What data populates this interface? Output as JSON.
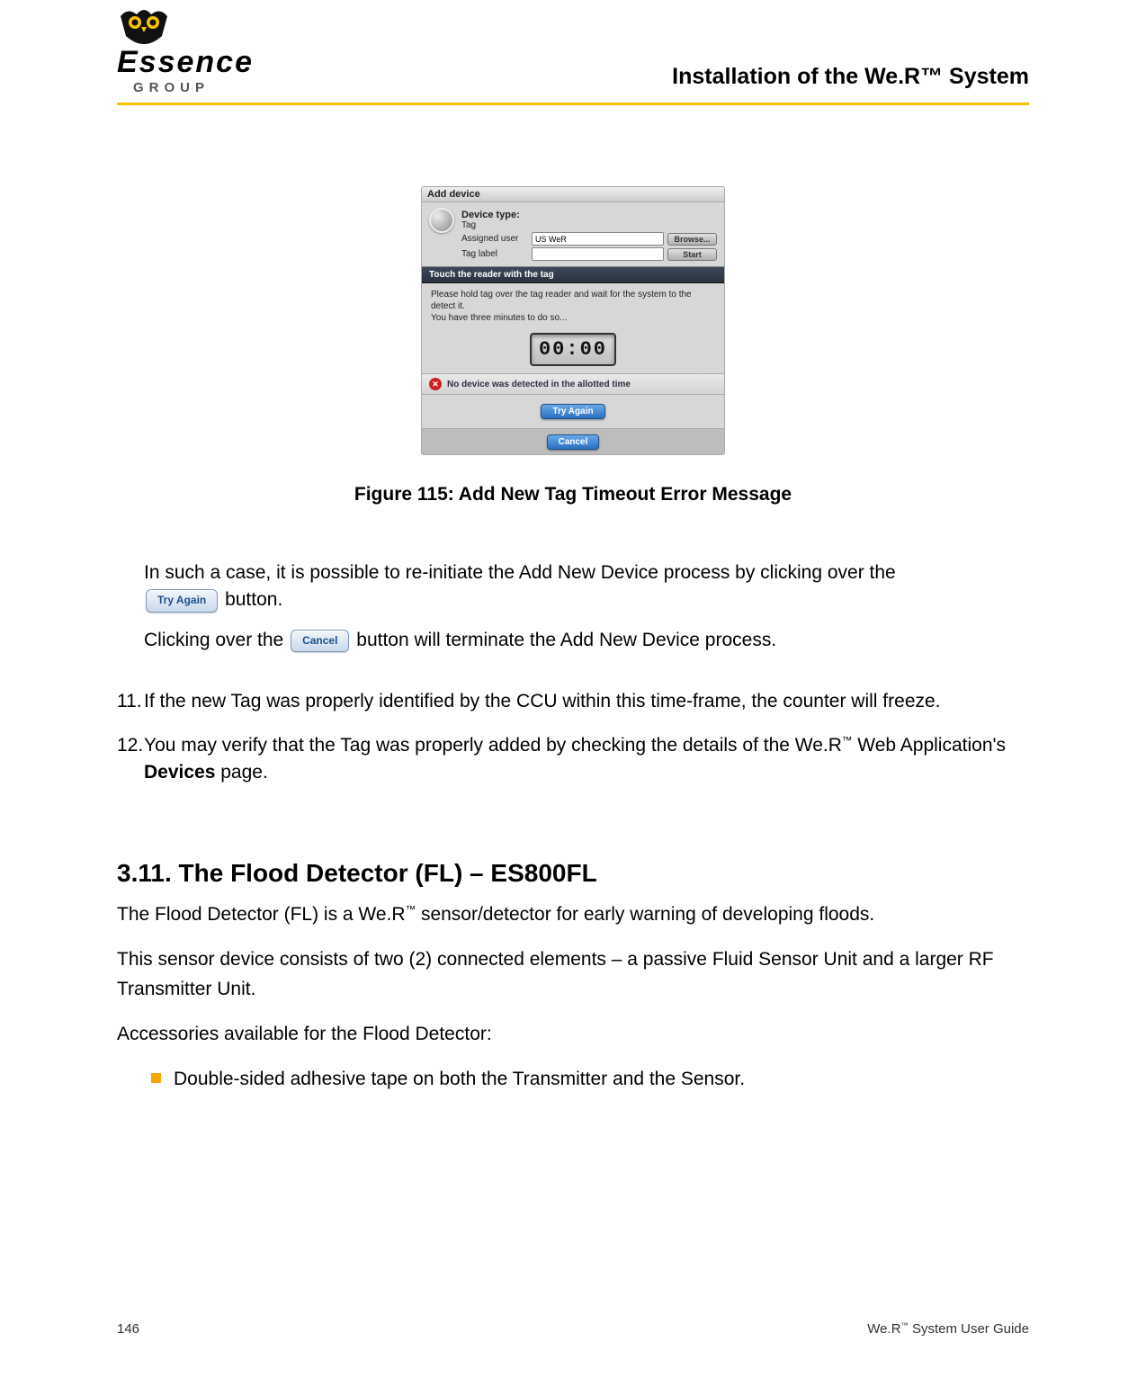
{
  "brand": {
    "name": "Essence",
    "sub": "GROUP"
  },
  "header_title": "Installation of the We.R™ System",
  "dialog": {
    "title": "Add device",
    "device_type_label": "Device type:",
    "device_type_value": "Tag",
    "assigned_user_label": "Assigned user",
    "assigned_user_value": "US WeR",
    "browse_btn": "Browse...",
    "tag_label_label": "Tag label",
    "tag_label_value": "",
    "start_btn": "Start",
    "bar_text": "Touch the reader with the tag",
    "instruction": "Please hold tag over the tag reader and wait for the system to the detect it.\nYou have three minutes to do so...",
    "timer": "00:00",
    "error_text": "No device was detected in the allotted time",
    "try_again_btn": "Try Again",
    "cancel_btn": "Cancel"
  },
  "figure_caption": "Figure 115: Add New Tag Timeout Error Message",
  "para_try_1": "In such a case, it is possible to re-initiate the Add New Device process by clicking over the ",
  "para_try_2": " button.",
  "try_again_inline": "Try Again",
  "para_cancel_1": "Clicking over the ",
  "para_cancel_2": " button will terminate the Add New Device process.",
  "cancel_inline": "Cancel",
  "item11_num": "11.",
  "item11_text": "If the new Tag was properly identified by the CCU within this time-frame, the counter will freeze.",
  "item12_num": "12.",
  "item12_text_a": "You may verify that the Tag was properly added by checking the details of the We.R",
  "item12_text_b": " Web Application's ",
  "item12_text_c": " page.",
  "item12_bold": "Devices",
  "section_heading": "3.11.  The Flood Detector (FL) – ES800FL",
  "section_p1_a": "The Flood Detector (FL) is a We.R",
  "section_p1_b": " sensor/detector for early warning of developing floods.",
  "section_p2": "This sensor device consists of two (2) connected elements – a passive Fluid Sensor Unit and a larger RF Transmitter Unit.",
  "section_p3": "Accessories available for the Flood Detector:",
  "bullet1": "Double-sided adhesive tape on both the Transmitter and the Sensor.",
  "footer_page": "146",
  "footer_guide_a": "We.R",
  "footer_guide_b": " System User Guide"
}
